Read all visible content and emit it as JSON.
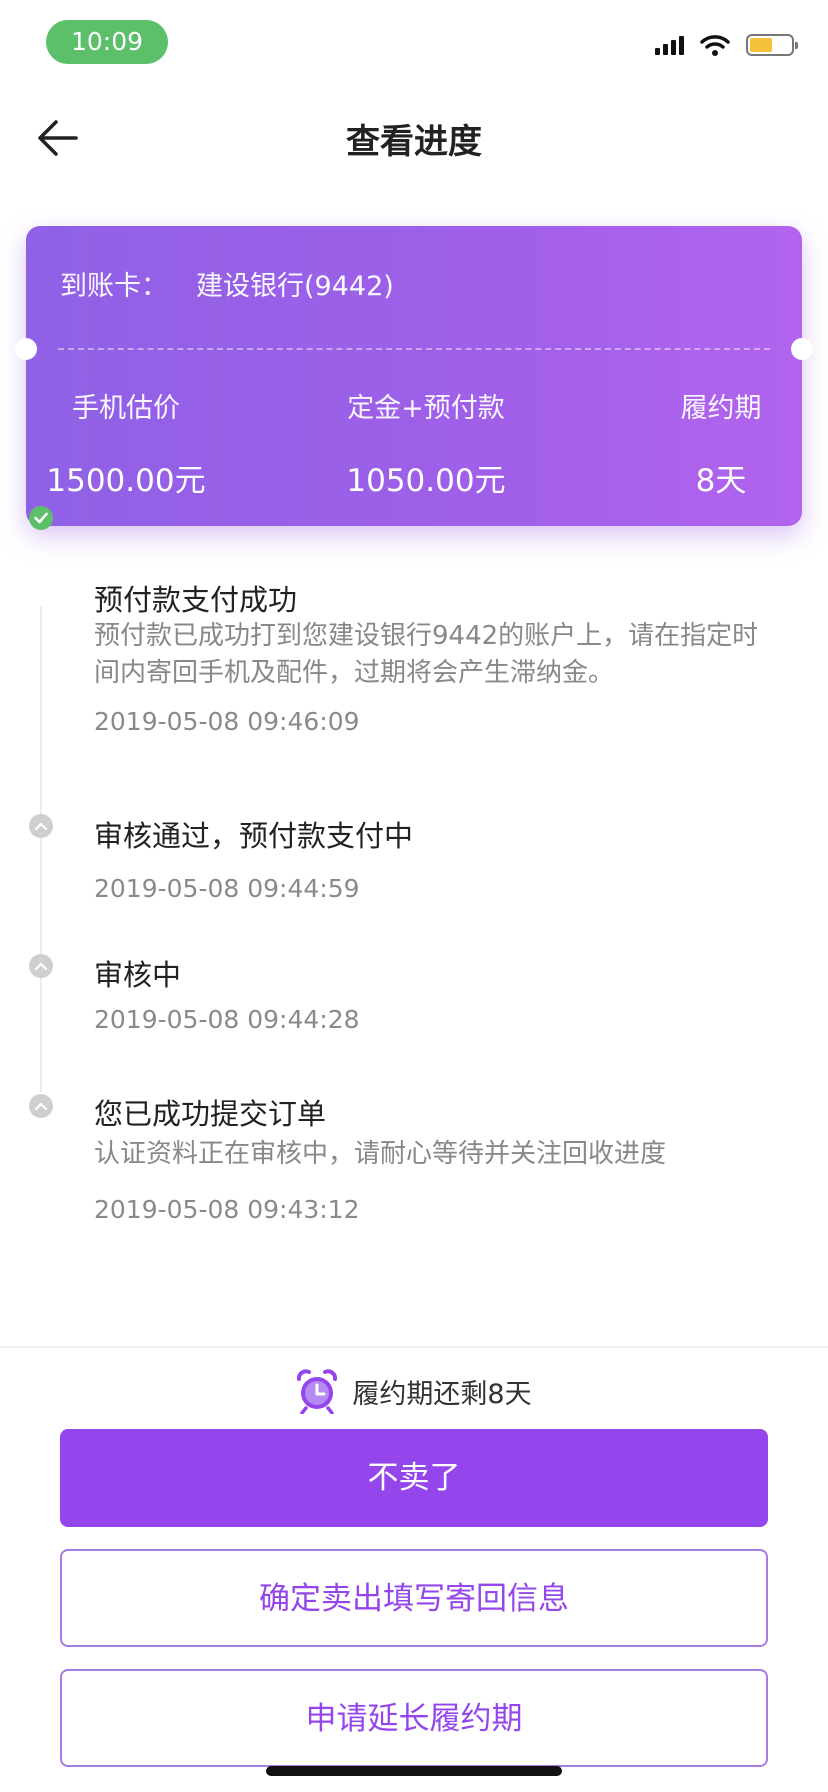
{
  "status_bar": {
    "time": "10:09"
  },
  "nav": {
    "title": "查看进度"
  },
  "card": {
    "account_label": "到账卡：",
    "bank": "建设银行(9442)",
    "columns": [
      {
        "label": "手机估价",
        "value": "1500.00元"
      },
      {
        "label": "定金+预付款",
        "value": "1050.00元"
      },
      {
        "label": "履约期",
        "value": "8天"
      }
    ]
  },
  "timeline": [
    {
      "title": "预付款支付成功",
      "desc": "预付款已成功打到您建设银行9442的账户上，请在指定时间内寄回手机及配件，过期将会产生滞纳金。",
      "time": "2019-05-08 09:46:09",
      "status": "done"
    },
    {
      "title": "审核通过，预付款支付中",
      "time": "2019-05-08 09:44:59",
      "status": "past"
    },
    {
      "title": "审核中",
      "time": "2019-05-08 09:44:28",
      "status": "past"
    },
    {
      "title": "您已成功提交订单",
      "desc": "认证资料正在审核中，请耐心等待并关注回收进度",
      "time": "2019-05-08 09:43:12",
      "status": "past"
    }
  ],
  "countdown": {
    "text": "履约期还剩8天"
  },
  "buttons": {
    "cancel": "不卖了",
    "confirm": "确定卖出填写寄回信息",
    "extend": "申请延长履约期"
  },
  "colors": {
    "accent": "#9446ec",
    "success": "#5cbf6a",
    "card_gradient_start": "#8f61e6",
    "card_gradient_end": "#b264ee"
  }
}
